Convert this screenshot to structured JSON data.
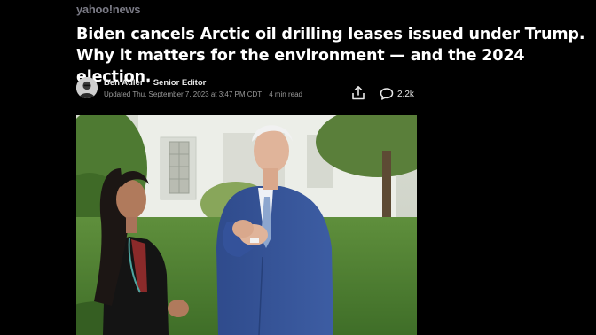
{
  "site": {
    "logo_text": "yahoo!news"
  },
  "article": {
    "headline": "Biden cancels Arctic oil drilling leases issued under Trump. Why it matters for the environment — and the 2024 election.",
    "author": {
      "name": "Ben Adler",
      "separator": "·",
      "role": "Senior Editor",
      "updated": "Updated Thu, September 7, 2023 at 3:47 PM CDT",
      "read_time": "4 min read"
    },
    "actions": {
      "share_icon": "share-icon",
      "comments_icon": "comment-bubble-icon",
      "comments_count": "2.2k"
    }
  },
  "colors": {
    "background": "#000000",
    "headline": "#ffffff",
    "logo": "#7a7a85",
    "meta_text": "#9a9a9a"
  }
}
